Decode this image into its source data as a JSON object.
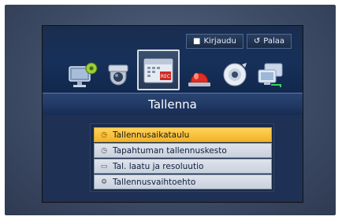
{
  "top_buttons": {
    "login_label": "Kirjaudu",
    "back_label": "Palaa"
  },
  "icons": [
    "monitor-settings-icon",
    "camera-dome-icon",
    "recording-calendar-icon",
    "alarm-bell-icon",
    "disc-device-icon",
    "network-monitors-icon"
  ],
  "page_title": "Tallenna",
  "menu": {
    "items": [
      {
        "label": "Tallennusaikataulu",
        "icon": "clock-icon",
        "active": true
      },
      {
        "label": "Tapahtuman tallennuskesto",
        "icon": "clock-icon",
        "active": false
      },
      {
        "label": "Tal. laatu ja resoluutio",
        "icon": "screen-icon",
        "active": false
      },
      {
        "label": "Tallennusvaihtoehto",
        "icon": "gear-icon",
        "active": false
      }
    ]
  },
  "colors": {
    "accent": "#f2b328",
    "header_blue": "#16305a",
    "content_blue": "#1e3154"
  }
}
